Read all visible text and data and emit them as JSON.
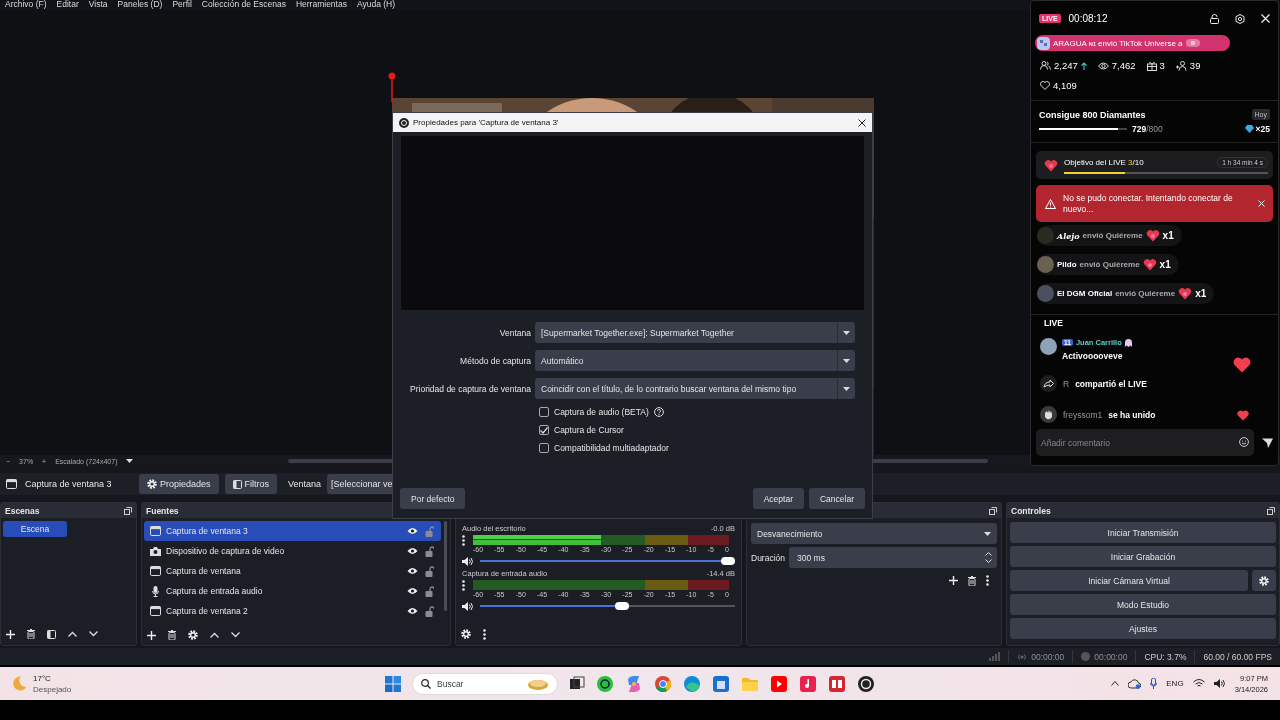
{
  "menu": [
    "Archivo (F)",
    "Editar",
    "Vista",
    "Paneles (D)",
    "Perfil",
    "Colección de Escenas",
    "Herramientas",
    "Ayuda (H)"
  ],
  "preview": {
    "zoom_out": "−",
    "zoom": "37%",
    "zoom_in": "+",
    "scale": "Escalado (724x407)"
  },
  "source_toolbar": {
    "source": "Captura de ventana 3",
    "buttons": [
      {
        "kind": "properties",
        "label": "Propiedades"
      },
      {
        "kind": "filters",
        "label": "Filtros"
      }
    ],
    "window_label": "Ventana",
    "window_value": "[Seleccionar ve"
  },
  "scenes": {
    "title": "Escenas",
    "items": [
      {
        "label": "Escena",
        "selected": true
      }
    ]
  },
  "sources": {
    "title": "Fuentes",
    "items": [
      {
        "label": "Captura de ventana 3",
        "kind": "window",
        "selected": true,
        "visible": true,
        "locked": false
      },
      {
        "label": "Dispositivo de captura de video",
        "kind": "camera",
        "selected": false,
        "visible": true,
        "locked": false
      },
      {
        "label": "Captura de ventana",
        "kind": "window",
        "selected": false,
        "visible": true,
        "locked": false
      },
      {
        "label": "Captura de entrada audio",
        "kind": "microphone",
        "selected": false,
        "visible": true,
        "locked": false
      },
      {
        "label": "Captura de ventana 2",
        "kind": "window",
        "selected": false,
        "visible": true,
        "locked": false
      }
    ]
  },
  "mixer": {
    "channels": [
      {
        "name": "Audio del escritorio",
        "reading": "-0.0 dB",
        "meter": {
          "level": 0.5
        },
        "volume": {
          "level": 1
        },
        "ticks": [
          "-60",
          "-55",
          "-50",
          "-45",
          "-40",
          "-35",
          "-30",
          "-25",
          "-20",
          "-15",
          "-10",
          "-5",
          "0"
        ]
      },
      {
        "name": "Captura de entrada audio",
        "reading": "-14.4 dB",
        "volume": {
          "level": 0.56
        },
        "ticks": [
          "-60",
          "-55",
          "-50",
          "-45",
          "-40",
          "-35",
          "-30",
          "-25",
          "-20",
          "-15",
          "-10",
          "-5",
          "0"
        ]
      }
    ]
  },
  "transitions": {
    "selected": "Desvanecimiento",
    "duration_label": "Duración",
    "duration": "300 ms"
  },
  "controls": {
    "title": "Controles",
    "buttons": [
      {
        "label": "Iniciar Transmisión",
        "settings": false
      },
      {
        "label": "Iniciar Grabación",
        "settings": false
      },
      {
        "label": "Iniciar Cámara Virtual",
        "settings": true
      },
      {
        "label": "Modo Estudio",
        "settings": false
      },
      {
        "label": "Ajustes",
        "settings": false
      }
    ]
  },
  "status_bar": {
    "stream_time": "00:00:00",
    "record_time": "00:00:00",
    "cpu": "CPU: 3.7%",
    "fps": "60.00 / 60.00 FPS"
  },
  "dialog": {
    "title": "Propiedades para 'Captura de ventana 3'",
    "fields": [
      {
        "label": "Ventana",
        "value": "[Supermarket Together.exe]: Supermarket Together"
      },
      {
        "label": "Método de captura",
        "value": "Automático"
      },
      {
        "label": "Prioridad de captura de ventana",
        "value": "Coincidir con el título, de lo contrario buscar ventana del mismo tipo"
      }
    ],
    "checkboxes": [
      {
        "label": "Captura de audio (BETA)",
        "checked": false,
        "help": true
      },
      {
        "label": "Captura de Cursor",
        "checked": true,
        "help": false
      },
      {
        "label": "Compatibilidad multiadaptador",
        "checked": false,
        "help": false
      }
    ],
    "buttons": [
      {
        "label": "Por defecto",
        "kind": "left"
      },
      {
        "label": "Aceptar",
        "kind": "right"
      },
      {
        "label": "Cancelar",
        "kind": "right"
      }
    ]
  },
  "tiktok": {
    "badge": "LIVE",
    "timer": "00:08:12",
    "banner": "ARAGUA ɴɪ envió TikTok Universe a",
    "stats": [
      {
        "kind": "viewers",
        "value": "2,247",
        "rising": true
      },
      {
        "kind": "views",
        "value": "7,462",
        "rising": false
      },
      {
        "kind": "gifts",
        "value": "3",
        "rising": false
      },
      {
        "kind": "followers",
        "value": "39",
        "rising": false
      },
      {
        "kind": "likes",
        "value": "4,109",
        "rising": false
      }
    ],
    "goal": {
      "title": "Consigue 800 Diamantes",
      "period": "Hoy",
      "level": 0.9,
      "current": "729",
      "target": "/800",
      "reward": "×25"
    },
    "objective": {
      "title": "Objetivo del LIVE",
      "count": "3",
      "total": "/10",
      "time": "1 h 34 min 4 s",
      "level": 0.3
    },
    "alert": {
      "message": "No se pudo conectar. Intentando conectar de nuevo..."
    },
    "gifts": [
      {
        "user": "Alejo",
        "action": "envió Quiéreme",
        "count": "x1"
      },
      {
        "user": "Pildo",
        "action": "envió Quiéreme",
        "count": "x1"
      },
      {
        "user": "El DGM Oficial",
        "action": "envió Quiéreme",
        "count": "x1"
      }
    ],
    "chat": [
      {
        "kind": "message",
        "text": "LIVE"
      },
      {
        "kind": "comment",
        "badge": "11",
        "user": "Juan Carrillo",
        "text": "Activooooveve"
      },
      {
        "kind": "share",
        "user": "R",
        "text": "compartió el LIVE"
      },
      {
        "kind": "join",
        "user": "freyssom1",
        "text": "se ha unido"
      }
    ],
    "comment_placeholder": "Añadir comentario"
  },
  "taskbar": {
    "temperature": "17°C",
    "condition": "Despejado",
    "search_placeholder": "Buscar",
    "language": "ENG",
    "time": "9:07 PM",
    "date": "3/14/2026"
  }
}
